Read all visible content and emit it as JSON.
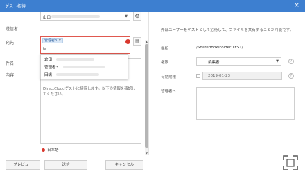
{
  "window": {
    "title": "ゲスト招待",
    "close_glyph": "×"
  },
  "left": {
    "sender_label": "送信者",
    "sender_value": "山口",
    "to_label": "宛先",
    "to_chip": "管理者3",
    "to_chip_remove": "×",
    "to_typed": "ta",
    "dropdown_items": [
      "倉田",
      "管理者3",
      "田嶋"
    ],
    "subject_label": "件名",
    "body_label": "内容",
    "body_text": "DirectCloudゲストに招待します。以下の情報を確認してください。",
    "language": "日本語"
  },
  "buttons": {
    "preview": "プレビュー",
    "send": "送信",
    "cancel": "キャンセル"
  },
  "right": {
    "message": "外部ユーザーをゲストとして招待して、ファイルを共有することが可能です。",
    "location_label": "場所",
    "location_value": "/SharedBox/Folder TEST/",
    "permission_label": "権限",
    "permission_value": "編集者",
    "expiry_label": "有効期限",
    "expiry_value": "2019-01-23",
    "admin_label": "管理者へ",
    "help_glyph": "?"
  },
  "icons": {
    "gear": "gear-icon",
    "address_book": "address-book-icon",
    "alert": "alert-icon",
    "fullscreen": "fullscreen-icon"
  },
  "colors": {
    "titlebar": "#3d7fd0",
    "error": "#d9372d",
    "chip_bg": "#d9e7f7"
  }
}
